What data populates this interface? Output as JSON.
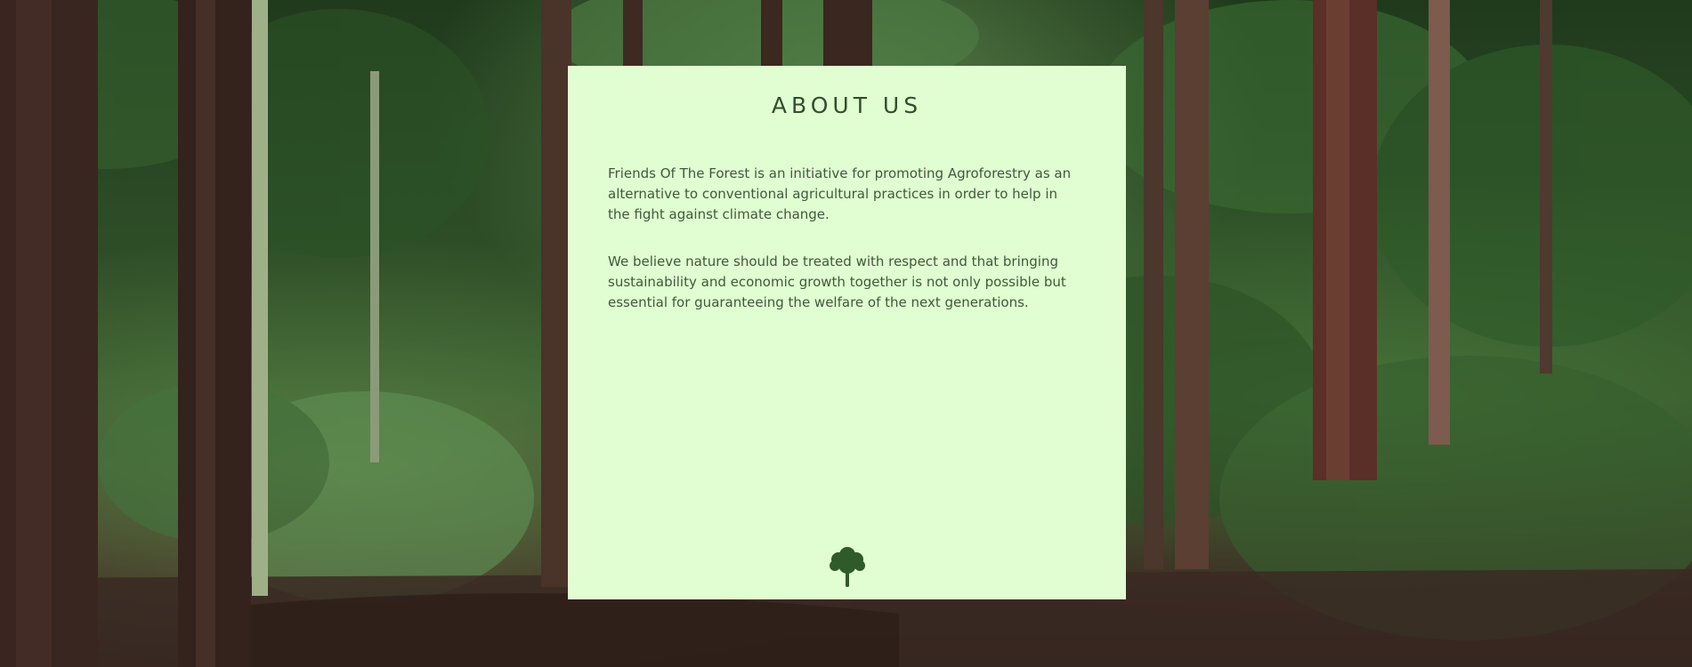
{
  "page": {
    "title": "ABOUT US",
    "paragraphs": [
      "Friends Of The Forest is an initiative for promoting Agroforestry as an alternative to conventional agricultural practices in order to help in the fight against climate change.",
      "We believe nature should be treated with respect and that bringing sustainability and economic growth together is not only possible but essential for guaranteeing the welfare of the next generations."
    ]
  },
  "icons": {
    "background": "forest-image",
    "footer_logo": "tree-icon"
  },
  "colors": {
    "card_background": "#e1fdd2",
    "title": "#2f4f2d",
    "text": "#3f5a3a",
    "tree": "#2f5a2a"
  }
}
